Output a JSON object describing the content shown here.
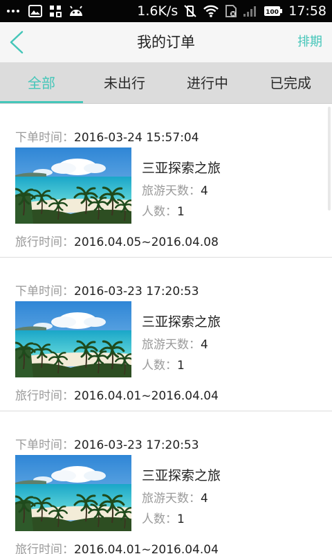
{
  "status_bar": {
    "network_speed": "1.6K/s",
    "battery": "100",
    "time": "17:58"
  },
  "header": {
    "title": "我的订单",
    "action": "排期"
  },
  "tabs": [
    {
      "label": "全部",
      "active": true
    },
    {
      "label": "未出行",
      "active": false
    },
    {
      "label": "进行中",
      "active": false
    },
    {
      "label": "已完成",
      "active": false
    }
  ],
  "labels": {
    "ordered_at": "下单时间：",
    "days": "旅游天数：",
    "people": "人数：",
    "travel_time": "旅行时间："
  },
  "orders": [
    {
      "ordered_at": "2016-03-24 15:57:04",
      "name": "三亚探索之旅",
      "days": "4",
      "people": "1",
      "travel_time": "2016.04.05~2016.04.08"
    },
    {
      "ordered_at": "2016-03-23 17:20:53",
      "name": "三亚探索之旅",
      "days": "4",
      "people": "1",
      "travel_time": "2016.04.01~2016.04.04"
    },
    {
      "ordered_at": "2016-03-23 17:20:53",
      "name": "三亚探索之旅",
      "days": "4",
      "people": "1",
      "travel_time": "2016.04.01~2016.04.04"
    }
  ],
  "colors": {
    "accent": "#45c6b9",
    "status_bar": "#050505",
    "header_bg": "#f6f6f6",
    "tab_bg": "#dcdcdc"
  }
}
